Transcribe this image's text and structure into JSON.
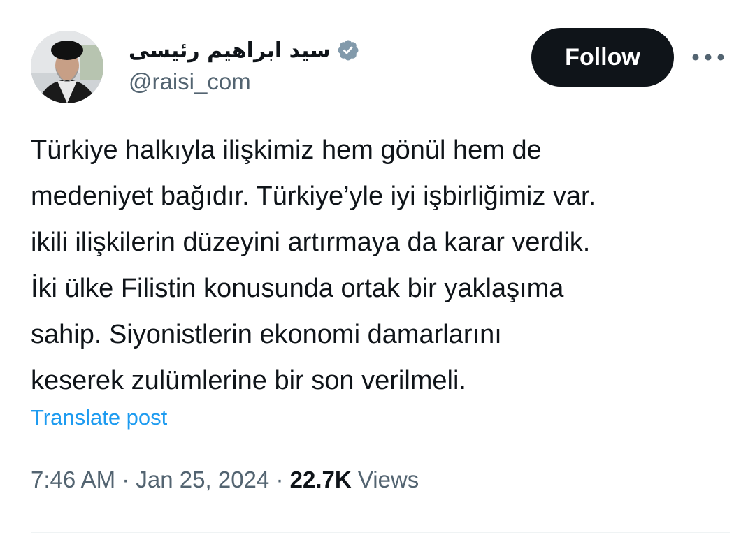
{
  "author": {
    "display_name": "سيد ابراهيم رئیسی",
    "handle": "@raisi_com",
    "verified": true,
    "verified_color": "#829aab",
    "avatar_icon": "profile-photo"
  },
  "actions": {
    "follow_label": "Follow",
    "more_icon": "more-horizontal-icon"
  },
  "post": {
    "lines": [
      "Türkiye halkıyla ilişkimiz hem gönül hem de",
      "medeniyet bağıdır. Türkiye’yle iyi işbirliğimiz var.",
      "ikili ilişkilerin düzeyini artırmaya da karar verdik.",
      "İki ülke Filistin konusunda ortak bir yaklaşıma",
      "sahip. Siyonistlerin ekonomi damarlarını",
      "keserek zulümlerine bir son verilmeli."
    ],
    "translate_label": "Translate post"
  },
  "meta": {
    "time": "7:46 AM",
    "separator": "·",
    "date": "Jan 25, 2024",
    "views_count": "22.7K",
    "views_label": "Views"
  },
  "colors": {
    "text": "#0f1419",
    "secondary": "#536471",
    "link": "#1d9bf0",
    "button_bg": "#0f1419"
  }
}
